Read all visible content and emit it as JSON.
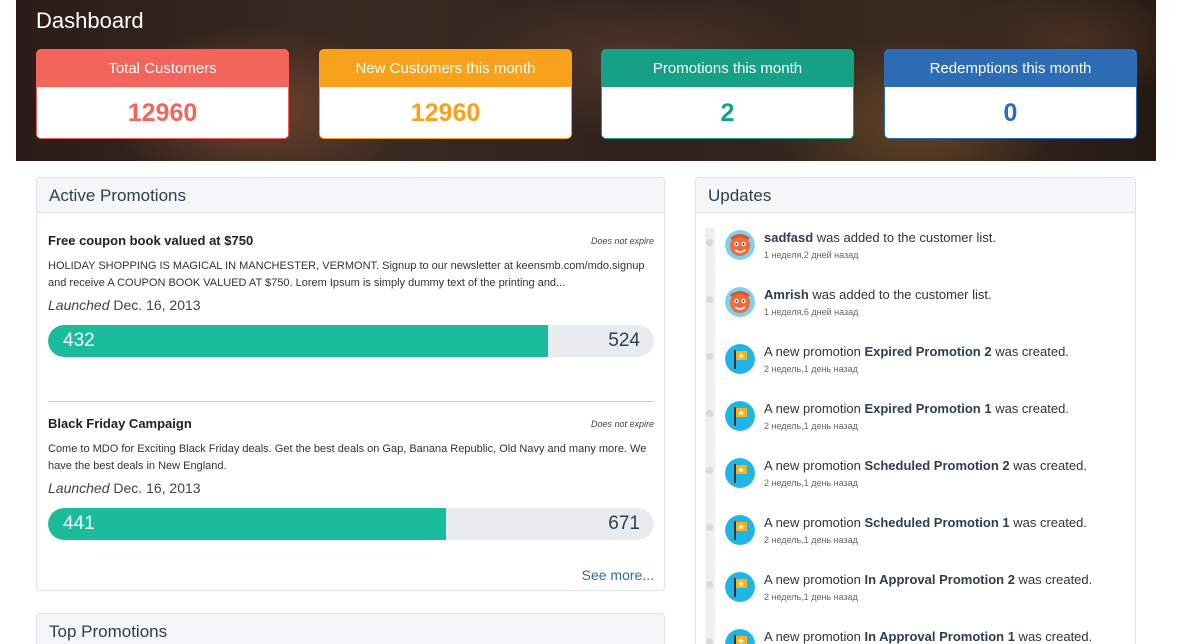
{
  "header": {
    "title": "Dashboard"
  },
  "stats": [
    {
      "label": "Total Customers",
      "value": "12960",
      "color": "#f3655b"
    },
    {
      "label": "New Customers this month",
      "value": "12960",
      "color": "#f8a11a"
    },
    {
      "label": "Promotions this month",
      "value": "2",
      "color": "#16a085"
    },
    {
      "label": "Redemptions this month",
      "value": "0",
      "color": "#2b6cb5"
    }
  ],
  "active_promotions": {
    "title": "Active Promotions",
    "items": [
      {
        "title": "Free coupon book valued at $750",
        "expire": "Does not expire",
        "description": "HOLIDAY SHOPPING IS MAGICAL IN MANCHESTER, VERMONT. Signup to our newsletter at keensmb.com/mdo.signup and receive A COUPON BOOK VALUED AT $750. Lorem Ipsum is simply dummy text of the printing and...",
        "launched_label": "Launched",
        "launched_date": "Dec. 16, 2013",
        "current": "432",
        "total": "524",
        "fill_fraction": 0.8244
      },
      {
        "title": "Black Friday Campaign",
        "expire": "Does not expire",
        "description": "Come to MDO for Exciting Black Friday deals. Get the best deals on Gap, Banana Republic, Old Navy and many more. We have the best deals in New England.",
        "launched_label": "Launched",
        "launched_date": "Dec. 16, 2013",
        "current": "441",
        "total": "671",
        "fill_fraction": 0.6572
      }
    ],
    "see_more": "See more..."
  },
  "top_promotions": {
    "title": "Top Promotions"
  },
  "updates": {
    "title": "Updates",
    "items": [
      {
        "type": "customer",
        "pre": "",
        "bold": "sadfasd",
        "post": " was added to the customer list.",
        "time": "1 неделя,2 дней назад"
      },
      {
        "type": "customer",
        "pre": "",
        "bold": "Amrish",
        "post": " was added to the customer list.",
        "time": "1 неделя,6 дней назад"
      },
      {
        "type": "promotion",
        "pre": "A new promotion ",
        "bold": "Expired Promotion 2",
        "post": " was created.",
        "time": "2 недель,1 день назад"
      },
      {
        "type": "promotion",
        "pre": "A new promotion ",
        "bold": "Expired Promotion 1",
        "post": " was created.",
        "time": "2 недель,1 день назад"
      },
      {
        "type": "promotion",
        "pre": "A new promotion ",
        "bold": "Scheduled Promotion 2",
        "post": " was created.",
        "time": "2 недель,1 день назад"
      },
      {
        "type": "promotion",
        "pre": "A new promotion ",
        "bold": "Scheduled Promotion 1",
        "post": " was created.",
        "time": "2 недель,1 день назад"
      },
      {
        "type": "promotion",
        "pre": "A new promotion ",
        "bold": "In Approval Promotion 2",
        "post": " was created.",
        "time": "2 недель,1 день назад"
      },
      {
        "type": "promotion",
        "pre": "A new promotion ",
        "bold": "In Approval Promotion 1",
        "post": " was created.",
        "time": ""
      }
    ]
  }
}
